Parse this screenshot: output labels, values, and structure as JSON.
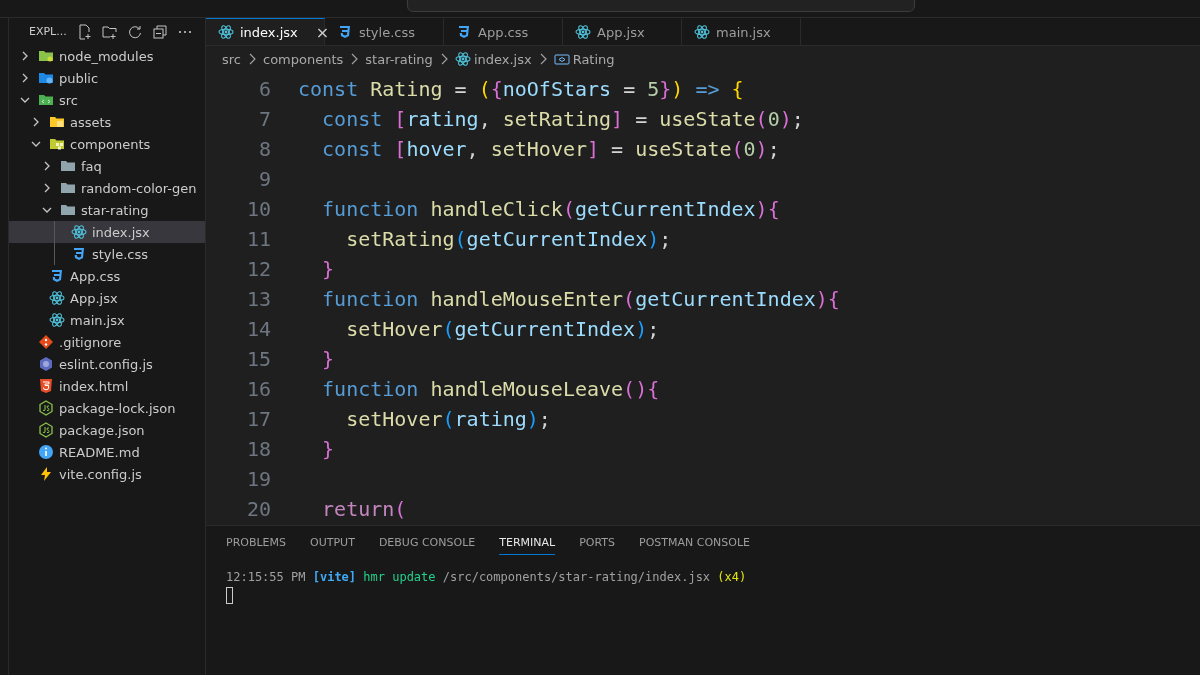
{
  "explorer": {
    "title": "EXPL...",
    "tree": [
      {
        "label": "node_modules",
        "kind": "folder-node",
        "expanded": false
      },
      {
        "label": "public",
        "kind": "folder-public",
        "expanded": false
      },
      {
        "label": "src",
        "kind": "folder-src",
        "expanded": true,
        "children": [
          {
            "label": "assets",
            "kind": "folder-assets",
            "expanded": false
          },
          {
            "label": "components",
            "kind": "folder-components",
            "expanded": true,
            "children": [
              {
                "label": "faq",
                "kind": "folder",
                "expanded": false
              },
              {
                "label": "random-color-gen",
                "kind": "folder",
                "expanded": false
              },
              {
                "label": "star-rating",
                "kind": "folder",
                "expanded": true,
                "children": [
                  {
                    "label": "index.jsx",
                    "kind": "react",
                    "selected": true
                  },
                  {
                    "label": "style.css",
                    "kind": "css",
                    "selected": false
                  }
                ]
              }
            ]
          },
          {
            "label": "App.css",
            "kind": "css",
            "selected": false
          },
          {
            "label": "App.jsx",
            "kind": "react",
            "selected": false
          },
          {
            "label": "main.jsx",
            "kind": "react",
            "selected": false
          }
        ]
      },
      {
        "label": ".gitignore",
        "kind": "git",
        "selected": false
      },
      {
        "label": "eslint.config.js",
        "kind": "eslint",
        "selected": false
      },
      {
        "label": "index.html",
        "kind": "html",
        "selected": false
      },
      {
        "label": "package-lock.json",
        "kind": "node",
        "selected": false
      },
      {
        "label": "package.json",
        "kind": "node",
        "selected": false
      },
      {
        "label": "README.md",
        "kind": "info",
        "selected": false
      },
      {
        "label": "vite.config.js",
        "kind": "vite",
        "selected": false
      }
    ]
  },
  "tabs": [
    {
      "label": "index.jsx",
      "kind": "react",
      "selected": true,
      "close": "×"
    },
    {
      "label": "style.css",
      "kind": "css",
      "selected": false
    },
    {
      "label": "App.css",
      "kind": "css",
      "selected": false
    },
    {
      "label": "App.jsx",
      "kind": "react",
      "selected": false
    },
    {
      "label": "main.jsx",
      "kind": "react",
      "selected": false
    }
  ],
  "breadcrumb": [
    {
      "label": "src",
      "kind": "folder"
    },
    {
      "label": "components",
      "kind": "folder"
    },
    {
      "label": "star-rating",
      "kind": "folder"
    },
    {
      "label": "index.jsx",
      "kind": "react"
    },
    {
      "label": "Rating",
      "kind": "symbol"
    }
  ],
  "code": [
    {
      "number": "6",
      "tokens": [
        {
          "text": "const ",
          "kind": "kw"
        },
        {
          "text": "Rating",
          "kind": "fn"
        },
        {
          "text": " = ",
          "kind": "op"
        },
        {
          "text": "(",
          "kind": "b1"
        },
        {
          "text": "{",
          "kind": "b2"
        },
        {
          "text": "noOfStars",
          "kind": "var"
        },
        {
          "text": " = ",
          "kind": "op"
        },
        {
          "text": "5",
          "kind": "num"
        },
        {
          "text": "}",
          "kind": "b2"
        },
        {
          "text": ")",
          "kind": "b1"
        },
        {
          "text": " => ",
          "kind": "kw"
        },
        {
          "text": "{",
          "kind": "b1"
        }
      ]
    },
    {
      "number": "7",
      "tokens": [
        {
          "text": "  const ",
          "kind": "kw"
        },
        {
          "text": "[",
          "kind": "b2"
        },
        {
          "text": "rating",
          "kind": "var"
        },
        {
          "text": ", ",
          "kind": "op"
        },
        {
          "text": "setRating",
          "kind": "fn"
        },
        {
          "text": "]",
          "kind": "b2"
        },
        {
          "text": " = ",
          "kind": "op"
        },
        {
          "text": "useState",
          "kind": "fn"
        },
        {
          "text": "(",
          "kind": "b2"
        },
        {
          "text": "0",
          "kind": "num"
        },
        {
          "text": ")",
          "kind": "b2"
        },
        {
          "text": ";",
          "kind": "op"
        }
      ]
    },
    {
      "number": "8",
      "tokens": [
        {
          "text": "  const ",
          "kind": "kw"
        },
        {
          "text": "[",
          "kind": "b2"
        },
        {
          "text": "hover",
          "kind": "var"
        },
        {
          "text": ", ",
          "kind": "op"
        },
        {
          "text": "setHover",
          "kind": "fn"
        },
        {
          "text": "]",
          "kind": "b2"
        },
        {
          "text": " = ",
          "kind": "op"
        },
        {
          "text": "useState",
          "kind": "fn"
        },
        {
          "text": "(",
          "kind": "b2"
        },
        {
          "text": "0",
          "kind": "num"
        },
        {
          "text": ")",
          "kind": "b2"
        },
        {
          "text": ";",
          "kind": "op"
        }
      ]
    },
    {
      "number": "9"
    },
    {
      "number": "10",
      "tokens": [
        {
          "text": "  function ",
          "kind": "kw"
        },
        {
          "text": "handleClick",
          "kind": "fn"
        },
        {
          "text": "(",
          "kind": "b2"
        },
        {
          "text": "getCurrentIndex",
          "kind": "var"
        },
        {
          "text": ")",
          "kind": "b2"
        },
        {
          "text": "{",
          "kind": "b2"
        }
      ]
    },
    {
      "number": "11",
      "tokens": [
        {
          "text": "    setRating",
          "kind": "fn"
        },
        {
          "text": "(",
          "kind": "b3"
        },
        {
          "text": "getCurrentIndex",
          "kind": "var"
        },
        {
          "text": ")",
          "kind": "b3"
        },
        {
          "text": ";",
          "kind": "op"
        }
      ]
    },
    {
      "number": "12",
      "tokens": [
        {
          "text": "  }",
          "kind": "b2"
        }
      ]
    },
    {
      "number": "13",
      "tokens": [
        {
          "text": "  function ",
          "kind": "kw"
        },
        {
          "text": "handleMouseEnter",
          "kind": "fn"
        },
        {
          "text": "(",
          "kind": "b2"
        },
        {
          "text": "getCurrentIndex",
          "kind": "var"
        },
        {
          "text": ")",
          "kind": "b2"
        },
        {
          "text": "{",
          "kind": "b2"
        }
      ]
    },
    {
      "number": "14",
      "tokens": [
        {
          "text": "    setHover",
          "kind": "fn"
        },
        {
          "text": "(",
          "kind": "b3"
        },
        {
          "text": "getCurrentIndex",
          "kind": "var"
        },
        {
          "text": ")",
          "kind": "b3"
        },
        {
          "text": ";",
          "kind": "op"
        }
      ]
    },
    {
      "number": "15",
      "tokens": [
        {
          "text": "  }",
          "kind": "b2"
        }
      ]
    },
    {
      "number": "16",
      "tokens": [
        {
          "text": "  function ",
          "kind": "kw"
        },
        {
          "text": "handleMouseLeave",
          "kind": "fn"
        },
        {
          "text": "()",
          "kind": "b2"
        },
        {
          "text": "{",
          "kind": "b2"
        }
      ]
    },
    {
      "number": "17",
      "tokens": [
        {
          "text": "    setHover",
          "kind": "fn"
        },
        {
          "text": "(",
          "kind": "b3"
        },
        {
          "text": "rating",
          "kind": "var"
        },
        {
          "text": ")",
          "kind": "b3"
        },
        {
          "text": ";",
          "kind": "op"
        }
      ]
    },
    {
      "number": "18",
      "tokens": [
        {
          "text": "  }",
          "kind": "b2"
        }
      ]
    },
    {
      "number": "19"
    },
    {
      "number": "20",
      "tokens": [
        {
          "text": "  return",
          "kind": "ctl"
        },
        {
          "text": "(",
          "kind": "b2"
        }
      ]
    }
  ],
  "panel": {
    "tabs": [
      {
        "label": "PROBLEMS",
        "selected": false
      },
      {
        "label": "OUTPUT",
        "selected": false
      },
      {
        "label": "DEBUG CONSOLE",
        "selected": false
      },
      {
        "label": "TERMINAL",
        "selected": true
      },
      {
        "label": "PORTS",
        "selected": false
      },
      {
        "label": "POSTMAN CONSOLE",
        "selected": false
      }
    ],
    "terminal": [
      {
        "text": "12:15:55 PM ",
        "kind": "dim"
      },
      {
        "text": "[vite]",
        "kind": "cyan"
      },
      {
        "text": " hmr update",
        "kind": "green"
      },
      {
        "text": " /src/components/star-rating/index.jsx ",
        "kind": "dim"
      },
      {
        "text": "(x4)",
        "kind": "yellow"
      }
    ]
  }
}
